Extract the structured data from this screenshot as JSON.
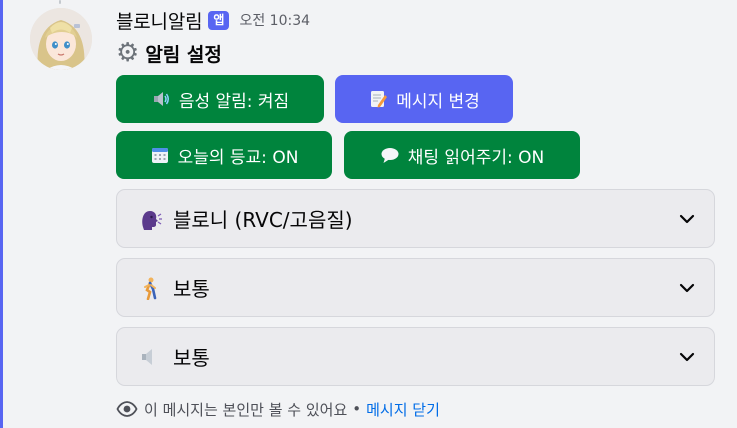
{
  "message": {
    "username": "블로니알림",
    "app_badge": "앱",
    "timestamp": "오전 10:34",
    "title": "알림 설정"
  },
  "buttons": {
    "voice_alert": "음성 알림: 켜짐",
    "change_message": "메시지 변경",
    "school_today": "오늘의 등교: ON",
    "chat_read": "채팅 읽어주기: ON"
  },
  "selects": {
    "voice": "블로니 (RVC/고음질)",
    "speed": "보통",
    "volume": "보통"
  },
  "footer": {
    "note": "이 메시지는 본인만 볼 수 있어요",
    "separator": "•",
    "dismiss": "메시지 닫기"
  },
  "colors": {
    "accent": "#5865f2",
    "success_button": "#00843d",
    "link": "#006ce7"
  },
  "icons": {
    "title": "gear-icon",
    "voice_alert": "speaker-icon",
    "change_message": "memo-icon",
    "school_today": "calendar-icon",
    "chat_read": "speech-bubble-icon",
    "voice": "speaking-head-icon",
    "speed": "walking-person-icon",
    "volume": "speaker-low-icon",
    "footer": "eye-icon"
  }
}
